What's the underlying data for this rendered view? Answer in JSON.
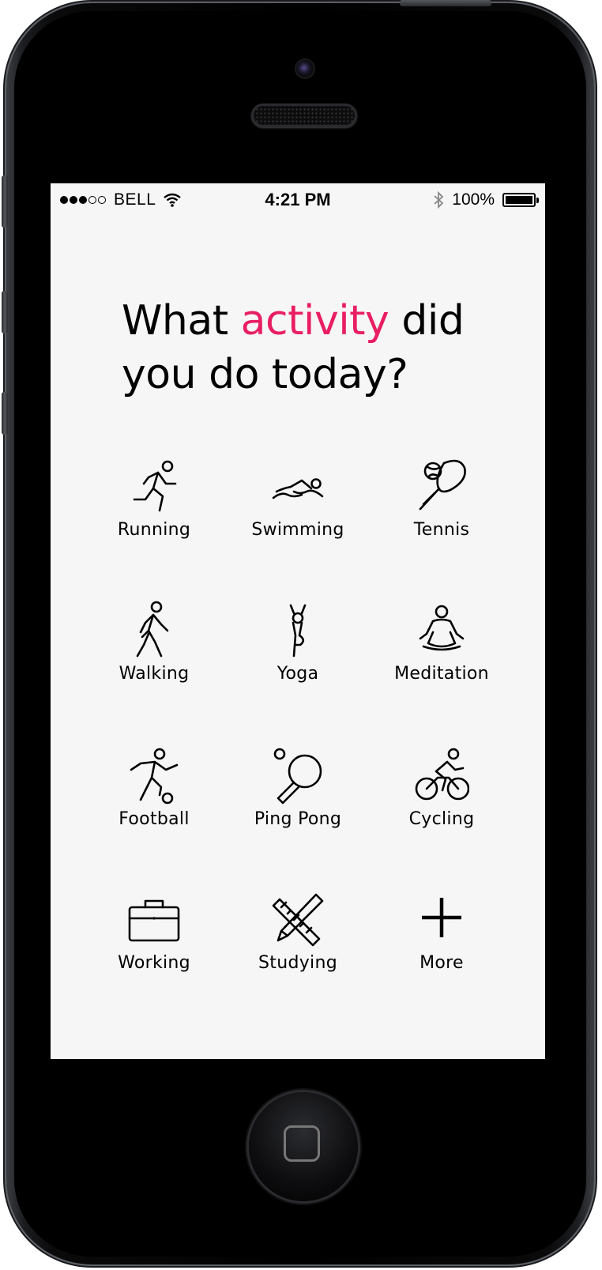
{
  "status_bar": {
    "signal": [
      "full",
      "full",
      "full",
      "empty",
      "empty"
    ],
    "carrier": "BELL",
    "time": "4:21 PM",
    "battery": "100%",
    "battery_level": 1.0
  },
  "prompt": {
    "before": "What ",
    "highlight": "activity",
    "after": " did you do today?",
    "accent_color": "#e91e63"
  },
  "activities": [
    {
      "label": "Running",
      "icon": "running-icon"
    },
    {
      "label": "Swimming",
      "icon": "swimming-icon"
    },
    {
      "label": "Tennis",
      "icon": "tennis-icon"
    },
    {
      "label": "Walking",
      "icon": "walking-icon"
    },
    {
      "label": "Yoga",
      "icon": "yoga-icon"
    },
    {
      "label": "Meditation",
      "icon": "meditation-icon"
    },
    {
      "label": "Football",
      "icon": "football-icon"
    },
    {
      "label": "Ping Pong",
      "icon": "ping-pong-icon"
    },
    {
      "label": "Cycling",
      "icon": "cycling-icon"
    },
    {
      "label": "Working",
      "icon": "briefcase-icon"
    },
    {
      "label": "Studying",
      "icon": "pencil-ruler-icon"
    },
    {
      "label": "More",
      "icon": "plus-icon"
    }
  ]
}
